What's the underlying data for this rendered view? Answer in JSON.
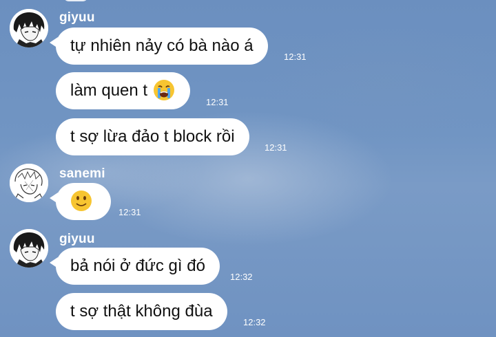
{
  "messages": [
    {
      "sender": "giyuu",
      "text": "tự nhiên nảy có bà nào á",
      "time": "12:31"
    },
    {
      "text": "làm quen t",
      "emoji": "loudly-crying-face",
      "time": "12:31"
    },
    {
      "text": "t sợ lừa đảo t block rồi",
      "time": "12:31"
    },
    {
      "sender": "sanemi",
      "emoji": "slightly-smiling-face",
      "time": "12:31"
    },
    {
      "sender": "giyuu",
      "text": "bả nói ở đức gì đó",
      "time": "12:32"
    },
    {
      "text": "t sợ thật không đùa",
      "time": "12:32"
    }
  ],
  "colors": {
    "background": "#7195c3",
    "bubble": "#ffffff",
    "sender_text": "#ffffff",
    "message_text": "#111111"
  }
}
